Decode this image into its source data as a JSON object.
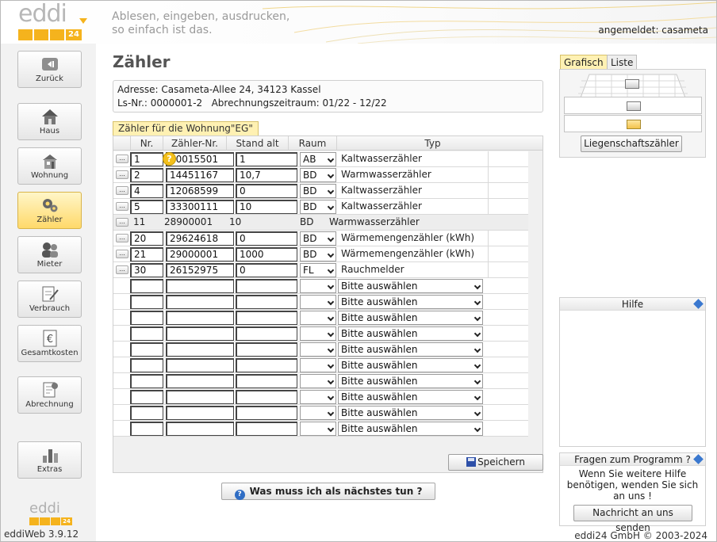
{
  "header": {
    "logo_text": "eddi",
    "logo_num": "24",
    "slogan_line1": "Ablesen, eingeben, ausdrucken,",
    "slogan_line2": "so einfach ist das.",
    "login": "angemeldet: casameta"
  },
  "sidebar": {
    "items": [
      {
        "label": "Zurück",
        "icon": "back-icon"
      },
      {
        "label": "Haus",
        "icon": "house-icon"
      },
      {
        "label": "Wohnung",
        "icon": "apartment-icon"
      },
      {
        "label": "Zähler",
        "icon": "gears-icon"
      },
      {
        "label": "Mieter",
        "icon": "tenants-icon"
      },
      {
        "label": "Verbrauch",
        "icon": "consumption-icon"
      },
      {
        "label": "Gesamtkosten",
        "icon": "euro-icon"
      },
      {
        "label": "Abrechnung",
        "icon": "billing-icon"
      },
      {
        "label": "Extras",
        "icon": "extras-icon"
      }
    ],
    "logo_text": "eddi",
    "logo_num": "24",
    "version": "eddiWeb 3.9.12"
  },
  "main": {
    "title": "Zähler",
    "address_line1": "Adresse: Casameta-Allee 24, 34123 Kassel",
    "address_line2": "Ls-Nr.: 0000001-2   Abrechnungszeitraum: 01/22 - 12/22",
    "unit_tab": "Zähler für die Wohnung\"EG\"",
    "table": {
      "headers": {
        "nr": "Nr.",
        "zaehler_nr": "Zähler-Nr.",
        "stand_alt": "Stand alt",
        "raum": "Raum",
        "typ": "Typ"
      },
      "edit_label": "...",
      "rows": [
        {
          "nr": "1",
          "zaehler_nr": "90015501",
          "stand_alt": "1",
          "raum": "AB",
          "typ": "Kaltwasserzähler"
        },
        {
          "nr": "2",
          "zaehler_nr": "14451167",
          "stand_alt": "10,7",
          "raum": "BD",
          "typ": "Warmwasserzähler"
        },
        {
          "nr": "4",
          "zaehler_nr": "12068599",
          "stand_alt": "0",
          "raum": "BD",
          "typ": "Kaltwasserzähler"
        },
        {
          "nr": "5",
          "zaehler_nr": "33300111",
          "stand_alt": "10",
          "raum": "BD",
          "typ": "Kaltwasserzähler"
        }
      ],
      "readonly_row": {
        "nr": "11",
        "zaehler_nr": "28900001",
        "stand_alt": "10",
        "raum": "BD",
        "typ": "Warmwasserzähler"
      },
      "rows2": [
        {
          "nr": "20",
          "zaehler_nr": "29624618",
          "stand_alt": "0",
          "raum": "BD",
          "typ": "Wärmemengenzähler (kWh)"
        },
        {
          "nr": "21",
          "zaehler_nr": "29000001",
          "stand_alt": "1000",
          "raum": "BD",
          "typ": "Wärmemengenzähler (kWh)"
        },
        {
          "nr": "30",
          "zaehler_nr": "26152975",
          "stand_alt": "0",
          "raum": "FL",
          "typ": "Rauchmelder"
        }
      ],
      "empty_select": "Bitte auswählen",
      "empty_row_count": 10
    },
    "save_label": "Speichern",
    "next_label": "Was muss ich als nächstes tun ?"
  },
  "right": {
    "tab_grafisch": "Grafisch",
    "tab_liste": "Liste",
    "liegen_btn": "Liegenschaftszähler",
    "hilfe_title": "Hilfe",
    "fragen_title": "Fragen zum Programm ?",
    "fragen_text": "Wenn Sie weitere Hilfe benötigen, wenden Sie sich an uns !",
    "send_btn": "Nachricht an uns senden"
  },
  "footer": "eddi24 GmbH © 2003-2024",
  "colors": {
    "accent": "#f5b31d",
    "active_tab": "#fff1b3",
    "active_nav": "#ffd96a",
    "help_blue": "#3a78cf"
  }
}
